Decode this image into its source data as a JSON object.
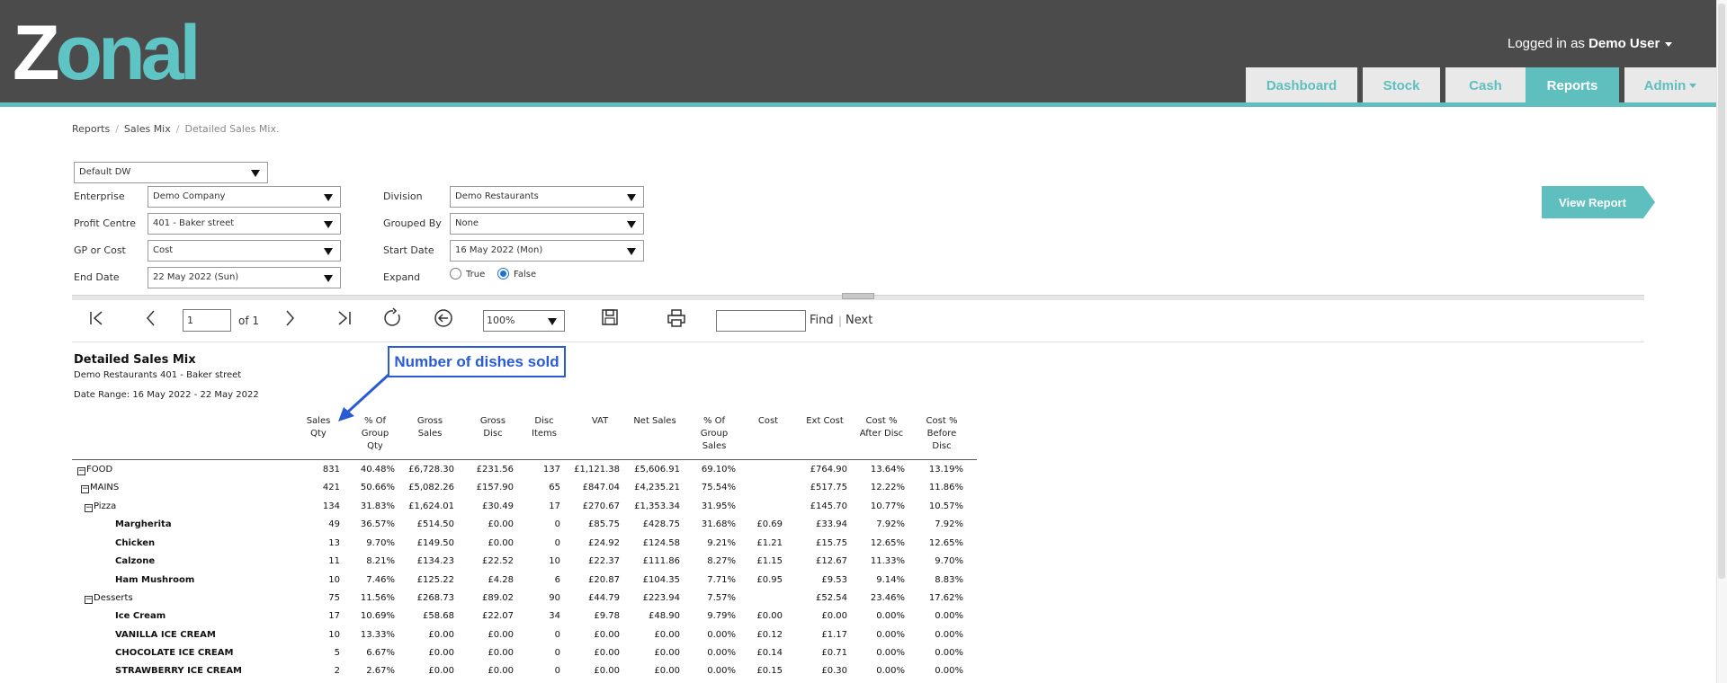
{
  "app": {
    "logo_text_a": "Z",
    "logo_text_b": "onal",
    "login_prefix": "Logged in as",
    "user": "Demo User"
  },
  "nav": {
    "tabs": [
      {
        "label": "Dashboard",
        "active": false
      },
      {
        "label": "Stock",
        "active": false
      },
      {
        "label": "Cash",
        "active": false
      },
      {
        "label": "Reports",
        "active": true
      },
      {
        "label": "Admin",
        "active": false
      }
    ]
  },
  "breadcrumb": [
    "Reports",
    "Sales Mix",
    "Detailed Sales Mix."
  ],
  "filters": {
    "datasource": "Default DW",
    "enterprise": {
      "label": "Enterprise",
      "value": "Demo Company"
    },
    "profit_centre": {
      "label": "Profit Centre",
      "value": "401 - Baker street"
    },
    "gp_or_cost": {
      "label": "GP or Cost",
      "value": "Cost"
    },
    "end_date": {
      "label": "End Date",
      "value": "22 May 2022 (Sun)"
    },
    "division": {
      "label": "Division",
      "value": "Demo Restaurants"
    },
    "grouped_by": {
      "label": "Grouped By",
      "value": "None"
    },
    "start_date": {
      "label": "Start Date",
      "value": "16 May 2022 (Mon)"
    },
    "expand": {
      "label": "Expand",
      "true_label": "True",
      "false_label": "False",
      "selected": "False"
    },
    "view_report": "View Report"
  },
  "toolbar": {
    "page": "1",
    "of_label": "of 1",
    "zoom": "100%",
    "find_label": "Find",
    "sep": "|",
    "next_label": "Next"
  },
  "report": {
    "title": "Detailed Sales Mix",
    "subtitle": "Demo Restaurants 401 - Baker street",
    "date_range": "Date Range: 16 May 2022 - 22 May 2022",
    "callout": "Number of dishes sold",
    "columns": [
      [
        "Sales",
        "Qty"
      ],
      [
        "% Of",
        "Group",
        "Qty"
      ],
      [
        "Gross",
        "Sales"
      ],
      [
        "Gross",
        "Disc"
      ],
      [
        "Disc",
        "Items"
      ],
      [
        "VAT"
      ],
      [
        "Net Sales"
      ],
      [
        "% Of",
        "Group",
        "Sales"
      ],
      [
        "Cost"
      ],
      [
        "Ext Cost"
      ],
      [
        "Cost %",
        "After Disc"
      ],
      [
        "Cost %",
        "Before",
        "Disc"
      ]
    ],
    "rows": [
      {
        "label": "FOOD",
        "level": 0,
        "toggle": true,
        "bold": false,
        "values": [
          "831",
          "40.48%",
          "£6,728.30",
          "£231.56",
          "137",
          "£1,121.38",
          "£5,606.91",
          "69.10%",
          "",
          "£764.90",
          "13.64%",
          "13.19%"
        ]
      },
      {
        "label": "MAINS",
        "level": 1,
        "toggle": true,
        "bold": false,
        "values": [
          "421",
          "50.66%",
          "£5,082.26",
          "£157.90",
          "65",
          "£847.04",
          "£4,235.21",
          "75.54%",
          "",
          "£517.75",
          "12.22%",
          "11.86%"
        ]
      },
      {
        "label": "Pizza",
        "level": 2,
        "toggle": true,
        "bold": false,
        "values": [
          "134",
          "31.83%",
          "£1,624.01",
          "£30.49",
          "17",
          "£270.67",
          "£1,353.34",
          "31.95%",
          "",
          "£145.70",
          "10.77%",
          "10.57%"
        ]
      },
      {
        "label": "Margherita",
        "level": 3,
        "toggle": false,
        "bold": true,
        "values": [
          "49",
          "36.57%",
          "£514.50",
          "£0.00",
          "0",
          "£85.75",
          "£428.75",
          "31.68%",
          "£0.69",
          "£33.94",
          "7.92%",
          "7.92%"
        ]
      },
      {
        "label": "Chicken",
        "level": 3,
        "toggle": false,
        "bold": true,
        "values": [
          "13",
          "9.70%",
          "£149.50",
          "£0.00",
          "0",
          "£24.92",
          "£124.58",
          "9.21%",
          "£1.21",
          "£15.75",
          "12.65%",
          "12.65%"
        ]
      },
      {
        "label": "Calzone",
        "level": 3,
        "toggle": false,
        "bold": true,
        "values": [
          "11",
          "8.21%",
          "£134.23",
          "£22.52",
          "10",
          "£22.37",
          "£111.86",
          "8.27%",
          "£1.15",
          "£12.67",
          "11.33%",
          "9.70%"
        ]
      },
      {
        "label": "Ham Mushroom",
        "level": 3,
        "toggle": false,
        "bold": true,
        "values": [
          "10",
          "7.46%",
          "£125.22",
          "£4.28",
          "6",
          "£20.87",
          "£104.35",
          "7.71%",
          "£0.95",
          "£9.53",
          "9.14%",
          "8.83%"
        ]
      },
      {
        "label": "Desserts",
        "level": 2,
        "toggle": true,
        "bold": false,
        "values": [
          "75",
          "11.56%",
          "£268.73",
          "£89.02",
          "90",
          "£44.79",
          "£223.94",
          "7.57%",
          "",
          "£52.54",
          "23.46%",
          "17.62%"
        ]
      },
      {
        "label": "Ice Cream",
        "level": 3,
        "toggle": false,
        "bold": true,
        "values": [
          "17",
          "10.69%",
          "£58.68",
          "£22.07",
          "34",
          "£9.78",
          "£48.90",
          "9.79%",
          "£0.00",
          "£0.00",
          "0.00%",
          "0.00%"
        ]
      },
      {
        "label": "VANILLA ICE CREAM",
        "level": 3,
        "toggle": false,
        "bold": true,
        "values": [
          "10",
          "13.33%",
          "£0.00",
          "£0.00",
          "0",
          "£0.00",
          "£0.00",
          "0.00%",
          "£0.12",
          "£1.17",
          "0.00%",
          "0.00%"
        ]
      },
      {
        "label": "CHOCOLATE ICE CREAM",
        "level": 3,
        "toggle": false,
        "bold": true,
        "values": [
          "5",
          "6.67%",
          "£0.00",
          "£0.00",
          "0",
          "£0.00",
          "£0.00",
          "0.00%",
          "£0.14",
          "£0.71",
          "0.00%",
          "0.00%"
        ]
      },
      {
        "label": "STRAWBERRY ICE CREAM",
        "level": 3,
        "toggle": false,
        "bold": true,
        "values": [
          "2",
          "2.67%",
          "£0.00",
          "£0.00",
          "0",
          "£0.00",
          "£0.00",
          "0.00%",
          "£0.15",
          "£0.30",
          "0.00%",
          "0.00%"
        ]
      }
    ]
  }
}
